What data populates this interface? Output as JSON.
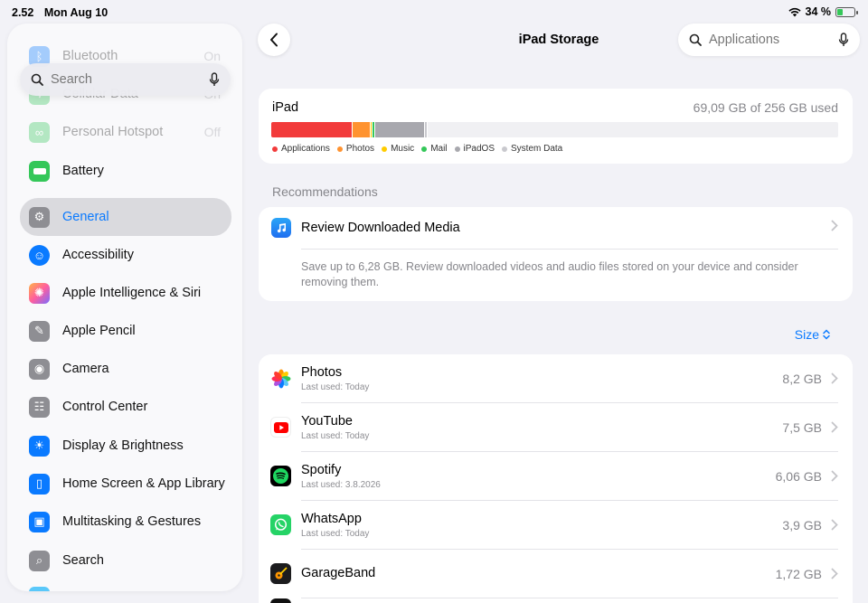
{
  "status": {
    "time": "2.52",
    "date": "Mon Aug 10",
    "battery": "34 %"
  },
  "sidebar": {
    "search_placeholder": "Search",
    "items": [
      {
        "label": "Bluetooth",
        "value": "On",
        "color": "#0a7aff",
        "icon": "bluetooth-icon"
      },
      {
        "label": "Cellular Data",
        "value": "On",
        "color": "#34c759",
        "icon": "antenna-icon"
      },
      {
        "label": "Personal Hotspot",
        "value": "Off",
        "color": "#34c759",
        "icon": "hotspot-icon"
      },
      {
        "label": "Battery",
        "value": "",
        "color": "#34c759",
        "icon": "battery-icon"
      },
      {
        "label": "General",
        "value": "",
        "color": "#8e8e93",
        "icon": "gear-icon"
      },
      {
        "label": "Accessibility",
        "value": "",
        "color": "#0a7aff",
        "icon": "accessibility-icon"
      },
      {
        "label": "Apple Intelligence & Siri",
        "value": "",
        "color": "#ff6b9d",
        "icon": "siri-icon"
      },
      {
        "label": "Apple Pencil",
        "value": "",
        "color": "#8e8e93",
        "icon": "pencil-icon"
      },
      {
        "label": "Camera",
        "value": "",
        "color": "#8e8e93",
        "icon": "camera-icon"
      },
      {
        "label": "Control Center",
        "value": "",
        "color": "#8e8e93",
        "icon": "toggles-icon"
      },
      {
        "label": "Display & Brightness",
        "value": "",
        "color": "#0a7aff",
        "icon": "sun-icon"
      },
      {
        "label": "Home Screen & App Library",
        "value": "",
        "color": "#0a7aff",
        "icon": "homescreen-icon"
      },
      {
        "label": "Multitasking & Gestures",
        "value": "",
        "color": "#0a7aff",
        "icon": "multitasking-icon"
      },
      {
        "label": "Search",
        "value": "",
        "color": "#8e8e93",
        "icon": "search-icon"
      }
    ]
  },
  "header": {
    "title": "iPad Storage",
    "search_placeholder": "Applications"
  },
  "storage": {
    "device": "iPad",
    "used_text": "69,09 GB of 256 GB used",
    "segments": [
      {
        "name": "Applications",
        "color": "#f23b3b",
        "fraction": 0.143
      },
      {
        "name": "Photos",
        "color": "#ff9330",
        "fraction": 0.032
      },
      {
        "name": "Music",
        "color": "#ffcc00",
        "fraction": 0.003
      },
      {
        "name": "Mail",
        "color": "#34c759",
        "fraction": 0.004
      },
      {
        "name": "iPadOS",
        "color": "#a8a8ae",
        "fraction": 0.087
      },
      {
        "name": "System Data",
        "color": "#c9c9ce",
        "fraction": 0.004
      }
    ]
  },
  "recommendations": {
    "label": "Recommendations",
    "title": "Review Downloaded Media",
    "description": "Save up to 6,28 GB. Review downloaded videos and audio files stored on your device and consider removing them."
  },
  "sort_label": "Size",
  "apps": [
    {
      "name": "Photos",
      "last_used": "Last used: Today",
      "size": "8,2 GB",
      "icon": "photos-icon"
    },
    {
      "name": "YouTube",
      "last_used": "Last used: Today",
      "size": "7,5 GB",
      "icon": "youtube-icon"
    },
    {
      "name": "Spotify",
      "last_used": "Last used: 3.8.2026",
      "size": "6,06 GB",
      "icon": "spotify-icon"
    },
    {
      "name": "WhatsApp",
      "last_used": "Last used: Today",
      "size": "3,9 GB",
      "icon": "whatsapp-icon"
    },
    {
      "name": "GarageBand",
      "last_used": "",
      "size": "1,72 GB",
      "icon": "garageband-icon"
    }
  ]
}
